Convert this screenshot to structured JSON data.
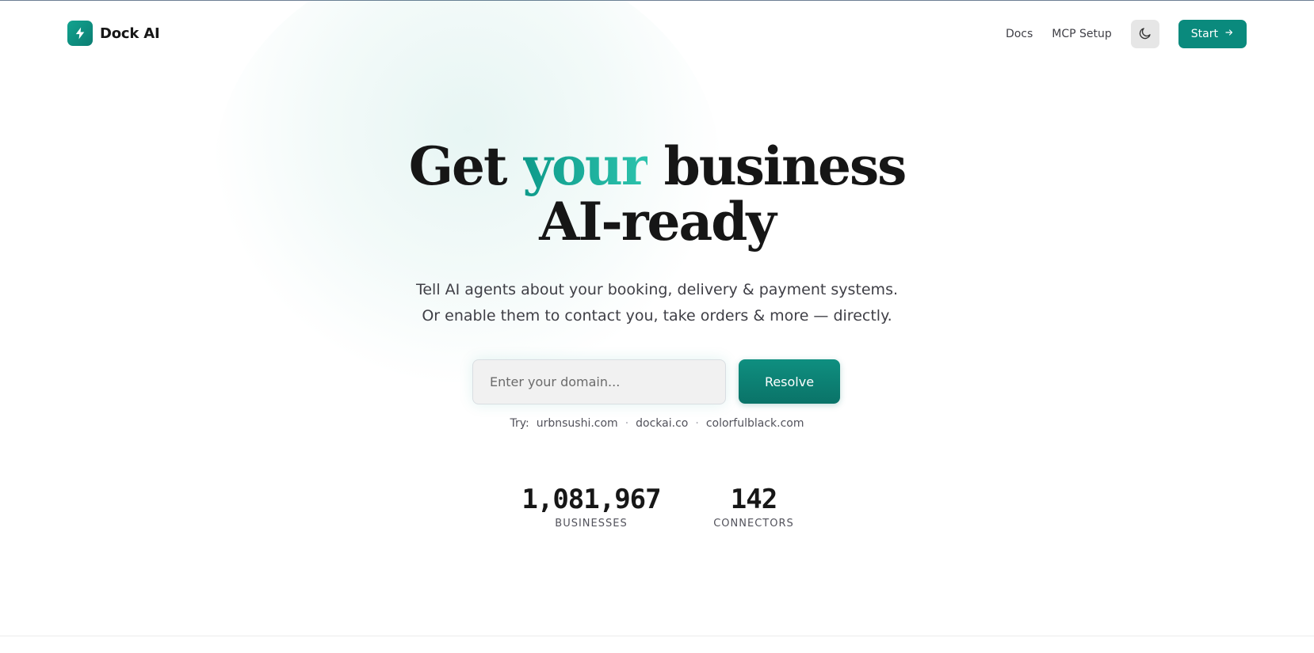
{
  "brand": {
    "name": "Dock AI",
    "icon": "lightning-bolt-icon",
    "accent_color": "#0a8a7d"
  },
  "nav": {
    "docs_label": "Docs",
    "mcp_setup_label": "MCP Setup",
    "theme_toggle_icon": "moon-icon",
    "start_label": "Start",
    "start_icon": "arrow-right-icon"
  },
  "hero": {
    "title_part1": "Get ",
    "title_accent": "your",
    "title_part2": " business",
    "title_line2": "AI-ready",
    "subtitle_line1": "Tell AI agents about your booking, delivery & payment systems.",
    "subtitle_line2": "Or enable them to contact you, take orders & more — directly."
  },
  "search": {
    "placeholder": "Enter your domain...",
    "value": "",
    "button_label": "Resolve",
    "try_label": "Try:",
    "examples": [
      "urbnsushi.com",
      "dockai.co",
      "colorfulblack.com"
    ],
    "separator": "·"
  },
  "stats": [
    {
      "value": "1,081,967",
      "label": "BUSINESSES"
    },
    {
      "value": "142",
      "label": "CONNECTORS"
    }
  ]
}
